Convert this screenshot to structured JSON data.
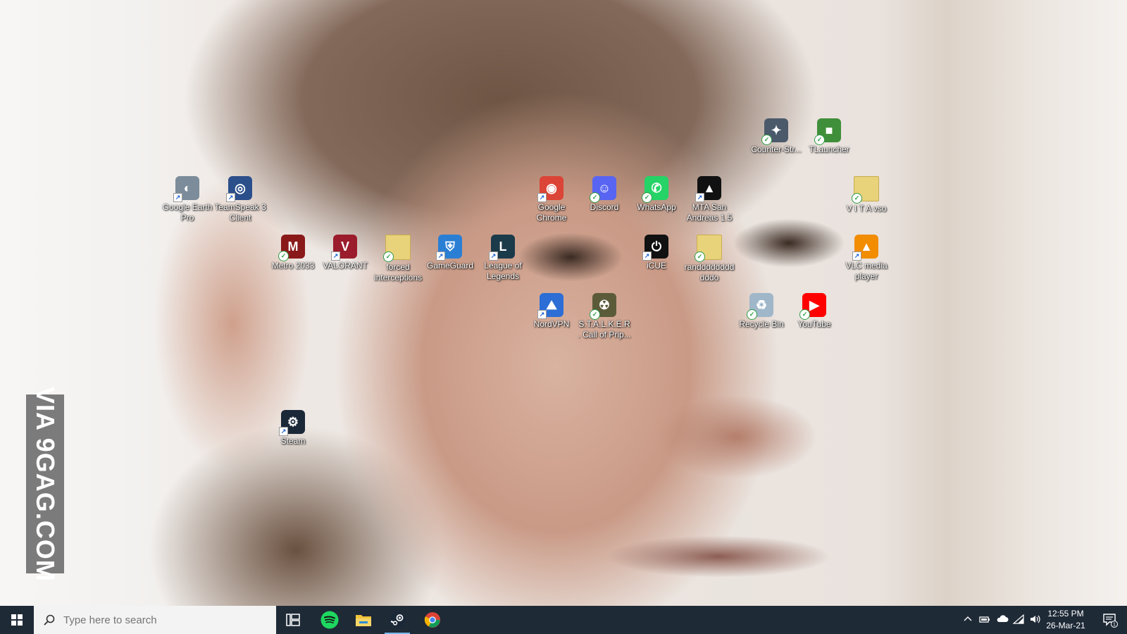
{
  "watermark": "VIA 9GAG.COM",
  "desktop_icons": [
    {
      "label": "Counter-Str...",
      "icon": "counter-strike-icon",
      "color": "#4a5a6b"
    },
    {
      "label": "TLauncher",
      "icon": "tlauncher-icon",
      "color": "#3f8f3a"
    },
    {
      "label": "Google Earth Pro",
      "icon": "google-earth-icon",
      "color": "#7c8c9a"
    },
    {
      "label": "TeamSpeak 3 Client",
      "icon": "teamspeak-icon",
      "color": "#2b4f8a"
    },
    {
      "label": "Google Chrome",
      "icon": "chrome-icon",
      "color": "#db4437"
    },
    {
      "label": "Discord",
      "icon": "discord-icon",
      "color": "#5865f2"
    },
    {
      "label": "WhatsApp",
      "icon": "whatsapp-icon",
      "color": "#25d366"
    },
    {
      "label": "MTA San Andreas 1.5",
      "icon": "mta-icon",
      "color": "#111111"
    },
    {
      "label": "V I T A    vso",
      "icon": "folder-icon",
      "color": "#e8d27a"
    },
    {
      "label": "Metro 2033",
      "icon": "metro-icon",
      "color": "#8a1a1a"
    },
    {
      "label": "VALORANT",
      "icon": "valorant-icon",
      "color": "#9b1c2c"
    },
    {
      "label": "forced interceptions",
      "icon": "folder-icon",
      "color": "#e8d27a"
    },
    {
      "label": "GameGuard",
      "icon": "gameguard-icon",
      "color": "#2a7fd4"
    },
    {
      "label": "League of Legends",
      "icon": "league-icon",
      "color": "#1b3a4a"
    },
    {
      "label": "iCUE",
      "icon": "icue-icon",
      "color": "#111111"
    },
    {
      "label": "randddddddddddo",
      "icon": "file-icon",
      "color": "#e8d27a"
    },
    {
      "label": "VLC media player",
      "icon": "vlc-icon",
      "color": "#f28c00"
    },
    {
      "label": "NordVPN",
      "icon": "nordvpn-icon",
      "color": "#2c6ed5"
    },
    {
      "label": "S.T.A.L.K.E.R. Call of Prip...",
      "icon": "stalker-icon",
      "color": "#5b5b3a"
    },
    {
      "label": "Recycle Bin",
      "icon": "recycle-bin-icon",
      "color": "#9fb7c9"
    },
    {
      "label": "YouTube",
      "icon": "youtube-icon",
      "color": "#ff0000"
    },
    {
      "label": "Steam",
      "icon": "steam-icon",
      "color": "#1b2838"
    }
  ],
  "taskbar": {
    "search_placeholder": "Type here to search",
    "pinned": [
      "task-view-icon",
      "spotify-icon",
      "file-explorer-icon",
      "steam-icon",
      "chrome-icon"
    ],
    "time": "12:55 PM",
    "date": "26-Mar-21",
    "notification_count": "1"
  }
}
